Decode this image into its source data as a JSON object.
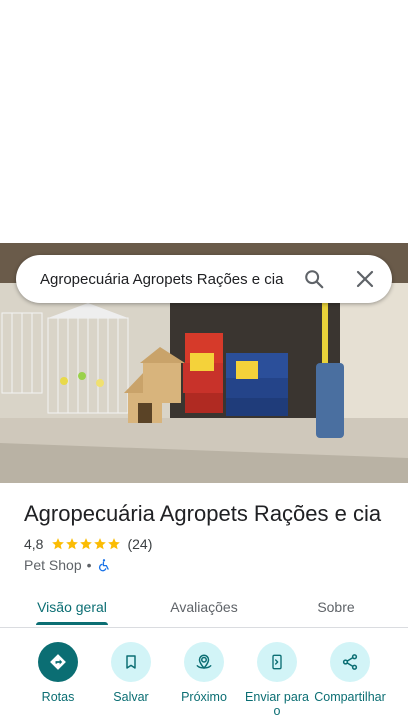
{
  "search": {
    "query": "Agropecuária Agropets Rações e cia"
  },
  "place": {
    "name": "Agropecuária Agropets Rações e cia",
    "rating": "4,8",
    "review_count": "(24)",
    "category": "Pet Shop",
    "separator": "•"
  },
  "tabs": [
    {
      "label": "Visão geral"
    },
    {
      "label": "Avaliações"
    },
    {
      "label": "Sobre"
    }
  ],
  "actions": [
    {
      "label": "Rotas",
      "icon": "directions-icon"
    },
    {
      "label": "Salvar",
      "icon": "bookmark-icon"
    },
    {
      "label": "Próximo",
      "icon": "nearby-icon"
    },
    {
      "label": "Enviar para o",
      "icon": "send-to-phone-icon"
    },
    {
      "label": "Compartilhar",
      "icon": "share-icon"
    }
  ],
  "colors": {
    "accent": "#0b6e73",
    "accent_light": "#d2f4f7",
    "star": "#fbbc04"
  }
}
